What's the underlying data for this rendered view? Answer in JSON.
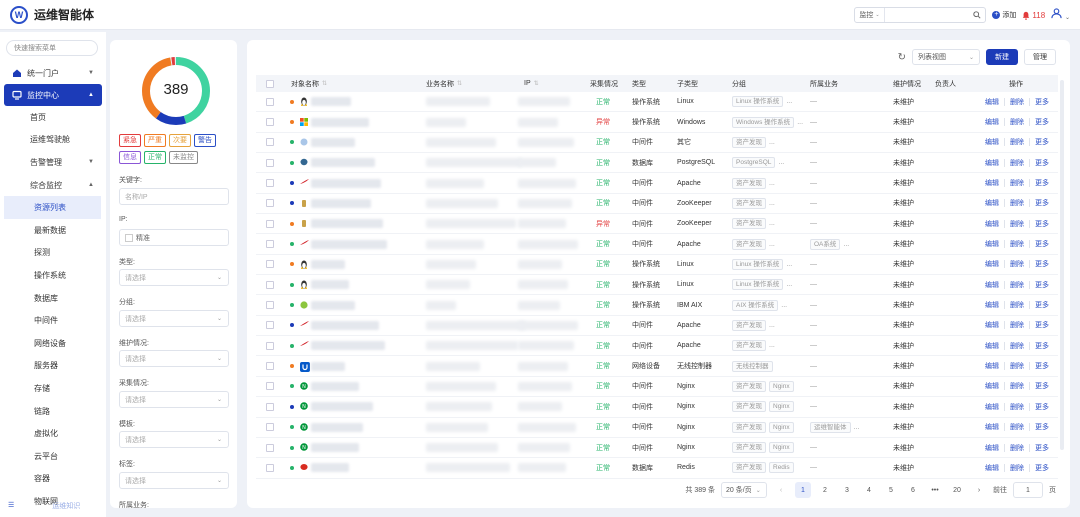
{
  "app": {
    "title": "运维智能体",
    "logo": "W"
  },
  "topbar": {
    "search_scope": "监控",
    "search_placeholder": "",
    "add_label": "添加",
    "alert_count": "118"
  },
  "sidebar": {
    "search_placeholder": "快速搜索菜单",
    "portal": "统一门户",
    "monitor": "监控中心",
    "items": [
      {
        "label": "首页",
        "level": 1
      },
      {
        "label": "运维驾驶舱",
        "level": 1
      },
      {
        "label": "告警管理",
        "level": 1,
        "arrow": "down"
      },
      {
        "label": "综合监控",
        "level": 1,
        "arrow": "up"
      },
      {
        "label": "资源列表",
        "level": 2,
        "active": true
      },
      {
        "label": "最新数据",
        "level": 2
      },
      {
        "label": "探测",
        "level": 2
      },
      {
        "label": "操作系统",
        "level": 2
      },
      {
        "label": "数据库",
        "level": 2
      },
      {
        "label": "中间件",
        "level": 2
      },
      {
        "label": "网络设备",
        "level": 2
      },
      {
        "label": "服务器",
        "level": 2
      },
      {
        "label": "存储",
        "level": 2
      },
      {
        "label": "链路",
        "level": 2
      },
      {
        "label": "虚拟化",
        "level": 2
      },
      {
        "label": "云平台",
        "level": 2
      },
      {
        "label": "容器",
        "level": 2
      },
      {
        "label": "物联网",
        "level": 2
      }
    ],
    "footer_right": "运维知识"
  },
  "filter": {
    "total": "389",
    "tags": [
      {
        "label": "紧急",
        "color": "#e23c3c"
      },
      {
        "label": "严重",
        "color": "#f07b22"
      },
      {
        "label": "次要",
        "color": "#e6a23c"
      },
      {
        "label": "警告",
        "color": "#2b4fc6"
      },
      {
        "label": "信息",
        "color": "#8a56d6"
      },
      {
        "label": "正常",
        "color": "#26b36a"
      },
      {
        "label": "未监控",
        "color": "#888888"
      }
    ],
    "keyword_label": "关键字:",
    "keyword_placeholder": "名称/IP",
    "ip_label": "IP:",
    "ip_exact": "精准",
    "type_label": "类型:",
    "group_label": "分组:",
    "maint_label": "维护情况:",
    "collect_label": "采集情况:",
    "template_label": "模板:",
    "tag_label": "标签:",
    "business_label": "所属业务:",
    "select_placeholder": "请选择"
  },
  "toolbar": {
    "view": "列表视图",
    "new": "新建",
    "manage": "管理"
  },
  "table": {
    "headers": {
      "name": "对象名称",
      "biz": "业务名称",
      "ip": "IP",
      "collect": "采集情况",
      "type": "类型",
      "subtype": "子类型",
      "group": "分组",
      "business": "所属业务",
      "maint": "维护情况",
      "owner": "负责人",
      "ops": "操作"
    },
    "ops": {
      "edit": "编辑",
      "delete": "删除",
      "more": "更多"
    },
    "rows": [
      {
        "dot": "#f07b22",
        "icon": "linux",
        "status": "正常",
        "ok": true,
        "type": "操作系统",
        "subtype": "Linux",
        "groups": [
          "Linux 操作系统"
        ],
        "gmore": "...",
        "biz": "—",
        "maint": "未维护"
      },
      {
        "dot": "#f07b22",
        "icon": "windows",
        "status": "异常",
        "ok": false,
        "type": "操作系统",
        "subtype": "Windows",
        "groups": [
          "Windows 操作系统"
        ],
        "gmore": "...",
        "biz": "—",
        "maint": "未维护"
      },
      {
        "dot": "#26b36a",
        "icon": "other",
        "status": "正常",
        "ok": true,
        "type": "中间件",
        "subtype": "其它",
        "groups": [
          "资产发现"
        ],
        "gmore": "...",
        "biz": "—",
        "maint": "未维护"
      },
      {
        "dot": "#26b36a",
        "icon": "pg",
        "status": "正常",
        "ok": true,
        "type": "数据库",
        "subtype": "PostgreSQL",
        "groups": [
          "PostgreSQL"
        ],
        "gmore": "...",
        "biz": "—",
        "maint": "未维护"
      },
      {
        "dot": "#1c3bb8",
        "icon": "apache",
        "status": "正常",
        "ok": true,
        "type": "中间件",
        "subtype": "Apache",
        "groups": [
          "资产发现"
        ],
        "gmore": "...",
        "biz": "—",
        "maint": "未维护"
      },
      {
        "dot": "#1c3bb8",
        "icon": "zk",
        "status": "正常",
        "ok": true,
        "type": "中间件",
        "subtype": "ZooKeeper",
        "groups": [
          "资产发现"
        ],
        "gmore": "...",
        "biz": "—",
        "maint": "未维护"
      },
      {
        "dot": "#f07b22",
        "icon": "zk",
        "status": "异常",
        "ok": false,
        "type": "中间件",
        "subtype": "ZooKeeper",
        "groups": [
          "资产发现"
        ],
        "gmore": "...",
        "biz": "—",
        "maint": "未维护"
      },
      {
        "dot": "#26b36a",
        "icon": "apache",
        "status": "正常",
        "ok": true,
        "type": "中间件",
        "subtype": "Apache",
        "groups": [
          "资产发现"
        ],
        "gmore": "...",
        "biz": "OA系统",
        "maint": "未维护"
      },
      {
        "dot": "#f07b22",
        "icon": "linux",
        "status": "正常",
        "ok": true,
        "type": "操作系统",
        "subtype": "Linux",
        "groups": [
          "Linux 操作系统"
        ],
        "gmore": "...",
        "biz": "—",
        "maint": "未维护"
      },
      {
        "dot": "#26b36a",
        "icon": "linux",
        "status": "正常",
        "ok": true,
        "type": "操作系统",
        "subtype": "Linux",
        "groups": [
          "Linux 操作系统"
        ],
        "gmore": "...",
        "biz": "—",
        "maint": "未维护"
      },
      {
        "dot": "#26b36a",
        "icon": "aix",
        "status": "正常",
        "ok": true,
        "type": "操作系统",
        "subtype": "IBM AIX",
        "groups": [
          "AIX 操作系统"
        ],
        "gmore": "...",
        "biz": "—",
        "maint": "未维护"
      },
      {
        "dot": "#1c3bb8",
        "icon": "apache",
        "status": "正常",
        "ok": true,
        "type": "中间件",
        "subtype": "Apache",
        "groups": [
          "资产发现"
        ],
        "gmore": "...",
        "biz": "—",
        "maint": "未维护"
      },
      {
        "dot": "#26b36a",
        "icon": "apache",
        "status": "正常",
        "ok": true,
        "type": "中间件",
        "subtype": "Apache",
        "groups": [
          "资产发现"
        ],
        "gmore": "...",
        "biz": "—",
        "maint": "未维护"
      },
      {
        "dot": "#f07b22",
        "icon": "ubnt",
        "status": "正常",
        "ok": true,
        "type": "网络设备",
        "subtype": "无线控制器",
        "groups": [
          "无线控制器"
        ],
        "gmore": "",
        "biz": "—",
        "maint": "未维护"
      },
      {
        "dot": "#26b36a",
        "icon": "nginx",
        "status": "正常",
        "ok": true,
        "type": "中间件",
        "subtype": "Nginx",
        "groups": [
          "资产发现",
          "Nginx"
        ],
        "gmore": "",
        "biz": "—",
        "maint": "未维护"
      },
      {
        "dot": "#1c3bb8",
        "icon": "nginx",
        "status": "正常",
        "ok": true,
        "type": "中间件",
        "subtype": "Nginx",
        "groups": [
          "资产发现",
          "Nginx"
        ],
        "gmore": "",
        "biz": "—",
        "maint": "未维护"
      },
      {
        "dot": "#26b36a",
        "icon": "nginx",
        "status": "正常",
        "ok": true,
        "type": "中间件",
        "subtype": "Nginx",
        "groups": [
          "资产发现",
          "Nginx"
        ],
        "gmore": "",
        "biz": "运维智能体",
        "maint": "未维护"
      },
      {
        "dot": "#26b36a",
        "icon": "nginx",
        "status": "正常",
        "ok": true,
        "type": "中间件",
        "subtype": "Nginx",
        "groups": [
          "资产发现",
          "Nginx"
        ],
        "gmore": "",
        "biz": "—",
        "maint": "未维护"
      },
      {
        "dot": "#26b36a",
        "icon": "redis",
        "status": "正常",
        "ok": true,
        "type": "数据库",
        "subtype": "Redis",
        "groups": [
          "资产发现",
          "Redis"
        ],
        "gmore": "",
        "biz": "—",
        "maint": "未维护"
      }
    ]
  },
  "pagination": {
    "total": "共 389 条",
    "page_size": "20 条/页",
    "pages": [
      "1",
      "2",
      "3",
      "4",
      "5",
      "6",
      "•••",
      "20"
    ],
    "current": "1",
    "goto_label": "前往",
    "goto_value": "1",
    "page_unit": "页"
  }
}
